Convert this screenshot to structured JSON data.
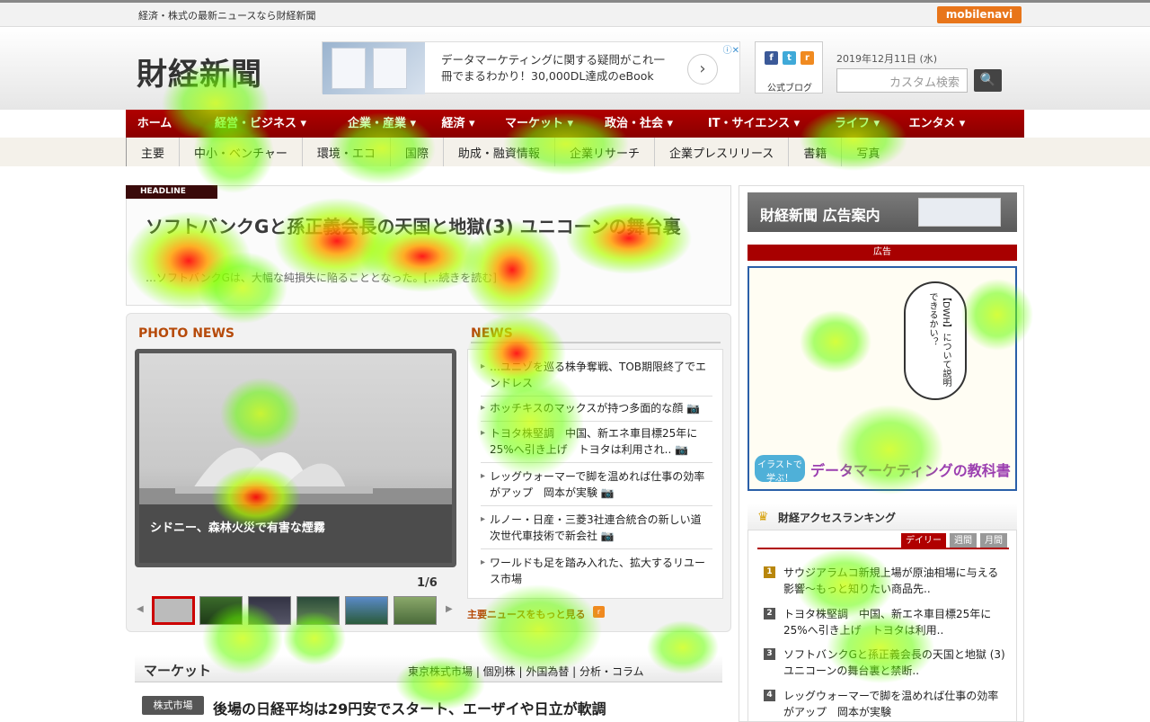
{
  "topbar": {
    "tagline": "経済・株式の最新ニュースなら財経新聞",
    "mobilenavi": "mobilenavi"
  },
  "header": {
    "logo": "財経新聞",
    "ad": {
      "text": "データマーケティングに関する疑問がこれ一冊でまるわかり！30,000DL達成のeBook",
      "arrow": "›",
      "close": "ⓘ✕"
    },
    "social": {
      "label": "公式ブログ",
      "icons": [
        "facebook-icon",
        "twitter-icon",
        "rss-icon"
      ]
    },
    "date": "2019年12月11日 (水)",
    "search": {
      "placeholder": "カスタム検索",
      "button": "🔍"
    }
  },
  "mainnav": [
    "ホーム",
    "経営・ビジネス ▾",
    "企業・産業 ▾",
    "経済 ▾",
    "マーケット ▾",
    "政治・社会 ▾",
    "IT・サイエンス ▾",
    "ライフ ▾",
    "エンタメ ▾"
  ],
  "subnav": [
    "主要",
    "中小・ベンチャー",
    "環境・エコ",
    "国際",
    "助成・融資情報",
    "企業リサーチ",
    "企業プレスリリース",
    "書籍",
    "写真"
  ],
  "headline": {
    "tag": "HEADLINE",
    "title": "ソフトバンクGと孫正義会長の天国と地獄(3) ユニコーンの舞台裏",
    "sub": "…ソフトバンクGは、大幅な純損失に陥ることとなった。[…続きを読む]"
  },
  "photonews": {
    "label": "PHOTO NEWS",
    "caption": "シドニー、森林火災で有害な煙霧",
    "counter": "1/6"
  },
  "news": {
    "label": "NEWS",
    "items": [
      "…ユニゾを巡る株争奪戦、TOB期限終了でエンドレス",
      "ホッチキスのマックスが持つ多面的な顔 📷",
      "トヨタ株堅調　中国、新エネ車目標25年に25%へ引き上げ　トヨタは利用され.. 📷",
      "レッグウォーマーで脚を温めれば仕事の効率がアップ　岡本が実験 📷",
      "ルノー・日産・三菱3社連合統合の新しい道　次世代車技術で新会社 📷",
      "ワールドも足を踏み入れた、拡大するリユース市場"
    ],
    "more": "主要ニュースをもっと見る"
  },
  "market": {
    "label": "マーケット",
    "links": "東京株式市場 |  個別株  |  外国為替 |  分析・コラム",
    "badge": "株式市場",
    "title": "後場の日経平均は29円安でスタート、エーザイや日立が軟調"
  },
  "sidebar": {
    "adguide": "財経新聞 広告案内",
    "adlabel": "広告",
    "bigad": {
      "speech": "【DWH】について説明できるかい？",
      "badge": "イラストで学ぶ！",
      "title": "データマーケティングの教科書"
    },
    "ranking": {
      "title": "財経アクセスランキング",
      "tabs": [
        "デイリー",
        "週間",
        "月間"
      ],
      "items": [
        "サウジアラムコ新規上場が原油相場に与える影響〜もっと知りたい商品先..",
        "トヨタ株堅調　中国、新エネ車目標25年に25%へ引き上げ　トヨタは利用..",
        "ソフトバンクGと孫正義会長の天国と地獄 (3) ユニコーンの舞台裏と禁断..",
        "レッグウォーマーで脚を温めれば仕事の効率がアップ　岡本が実験"
      ]
    }
  },
  "colors": {
    "nav": "#9a0000",
    "accent": "#b64a0a",
    "heat_hot": "#ff0000",
    "heat_cool": "#66ff00"
  }
}
